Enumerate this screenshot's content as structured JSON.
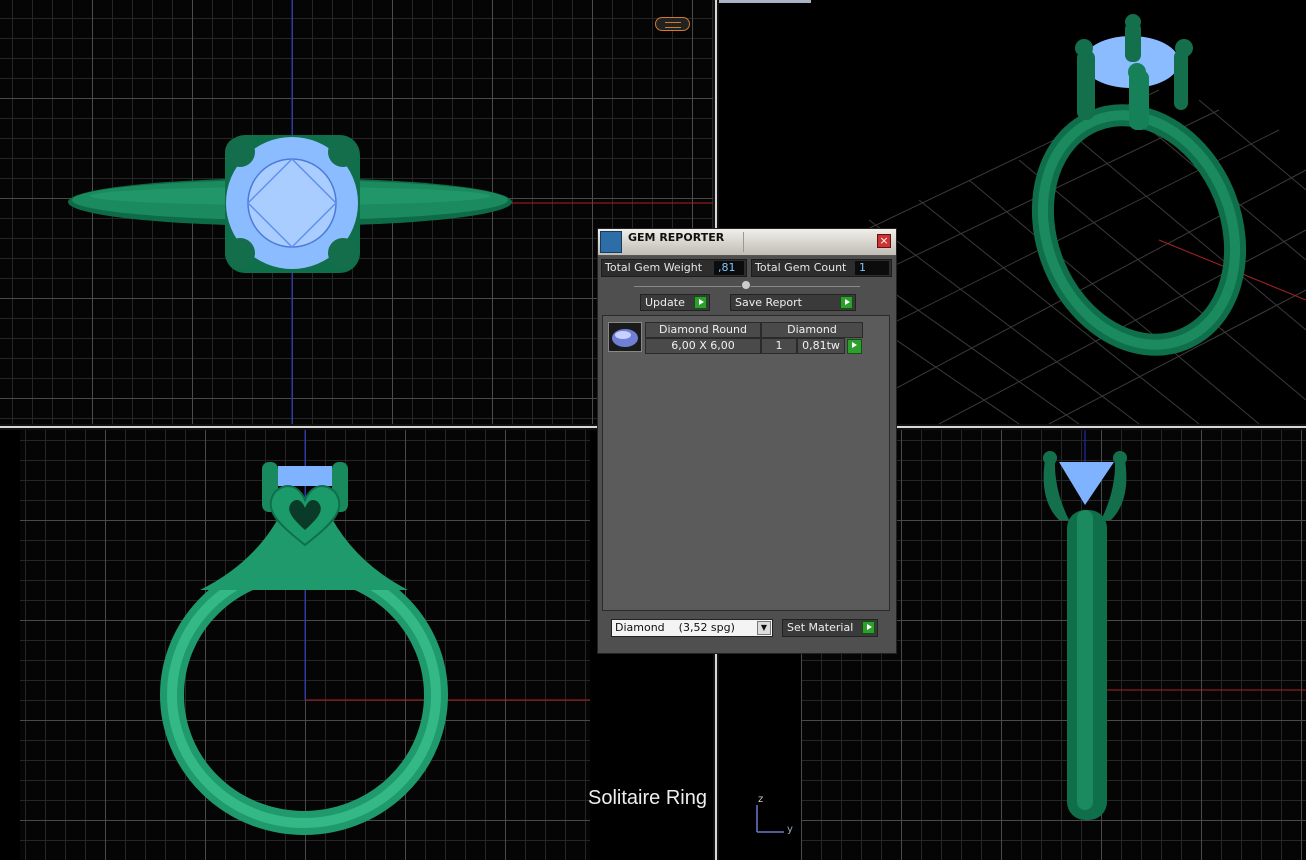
{
  "panel": {
    "title": "GEM REPORTER",
    "close_glyph": "×",
    "total_weight_label": "Total Gem Weight",
    "total_weight_value": ",81",
    "total_count_label": "Total Gem Count",
    "total_count_value": "1",
    "update_label": "Update",
    "save_report_label": "Save Report",
    "gems": [
      {
        "name": "Diamond Round",
        "size": "6,00 X 6,00",
        "material": "Diamond",
        "count": "1",
        "weight": "0,81tw"
      }
    ],
    "material_selected": "Diamond    (3,52 spg)",
    "set_material_label": "Set Material"
  },
  "caption": "Solitaire Ring",
  "axis": {
    "z": "z",
    "y": "y"
  },
  "icons": {
    "panel_logo": "gem-reporter-logo-icon",
    "play": "play-icon",
    "close": "close-icon",
    "dropdown": "chevron-down-icon",
    "gem_thumb": "gem-thumbnail-icon",
    "top_badge": "view-badge-icon"
  },
  "colors": {
    "metal": "#1a9a6a",
    "gem": "#7fb2ff",
    "accent_green": "#2e9e2e",
    "value_text": "#7cc6ff"
  }
}
